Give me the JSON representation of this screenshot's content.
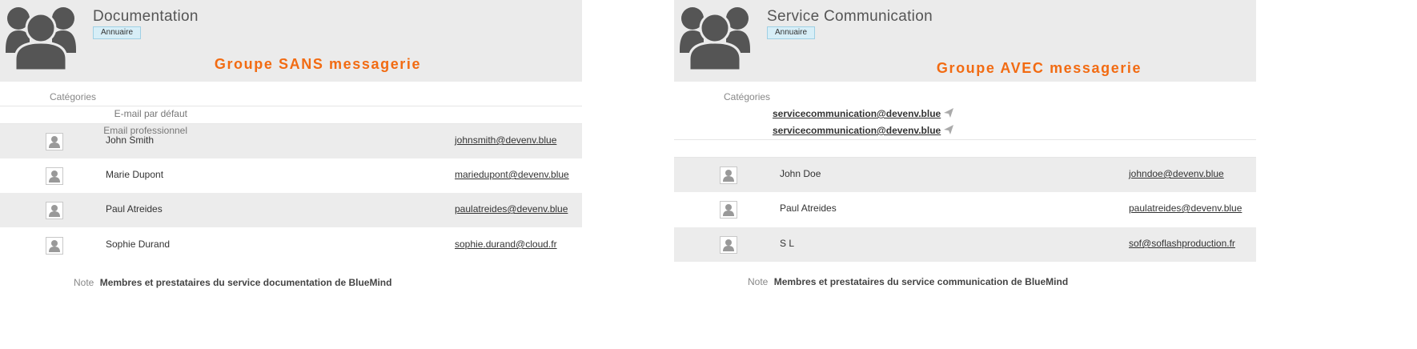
{
  "panels": [
    {
      "title": "Documentation",
      "badge": "Annuaire",
      "group_note": "Groupe SANS messagerie",
      "categories_label": "Catégories",
      "members": [
        {
          "name": "John Smith",
          "email": "johnsmith@devenv.blue"
        },
        {
          "name": "Marie Dupont",
          "email": "mariedupont@devenv.blue"
        },
        {
          "name": "Paul Atreides",
          "email": "paulatreides@devenv.blue"
        },
        {
          "name": "Sophie Durand",
          "email": "sophie.durand@cloud.fr"
        }
      ],
      "note_label": "Note",
      "note_value": "Membres et prestataires du service documentation de BlueMind"
    },
    {
      "title": "Service Communication",
      "badge": "Annuaire",
      "group_note": "Groupe AVEC messagerie",
      "categories_label": "Catégories",
      "emails": [
        {
          "label": "E-mail par défaut",
          "value": "servicecommunication@devenv.blue"
        },
        {
          "label": "Email professionnel",
          "value": "servicecommunication@devenv.blue"
        }
      ],
      "members": [
        {
          "name": "John Doe",
          "email": "johndoe@devenv.blue"
        },
        {
          "name": "Paul Atreides",
          "email": "paulatreides@devenv.blue"
        },
        {
          "name": "S L",
          "email": "sof@soflashproduction.fr"
        }
      ],
      "note_label": "Note",
      "note_value": "Membres et prestataires du service communication de BlueMind"
    }
  ],
  "colors": {
    "accent": "#f26b12",
    "header_bg": "#ebebeb",
    "row_alt": "#ececec",
    "badge_bg": "#d7eef7"
  },
  "icons": {
    "group": "group-avatar-icon",
    "contact": "contact-placeholder-icon",
    "send": "send-mail-icon"
  }
}
